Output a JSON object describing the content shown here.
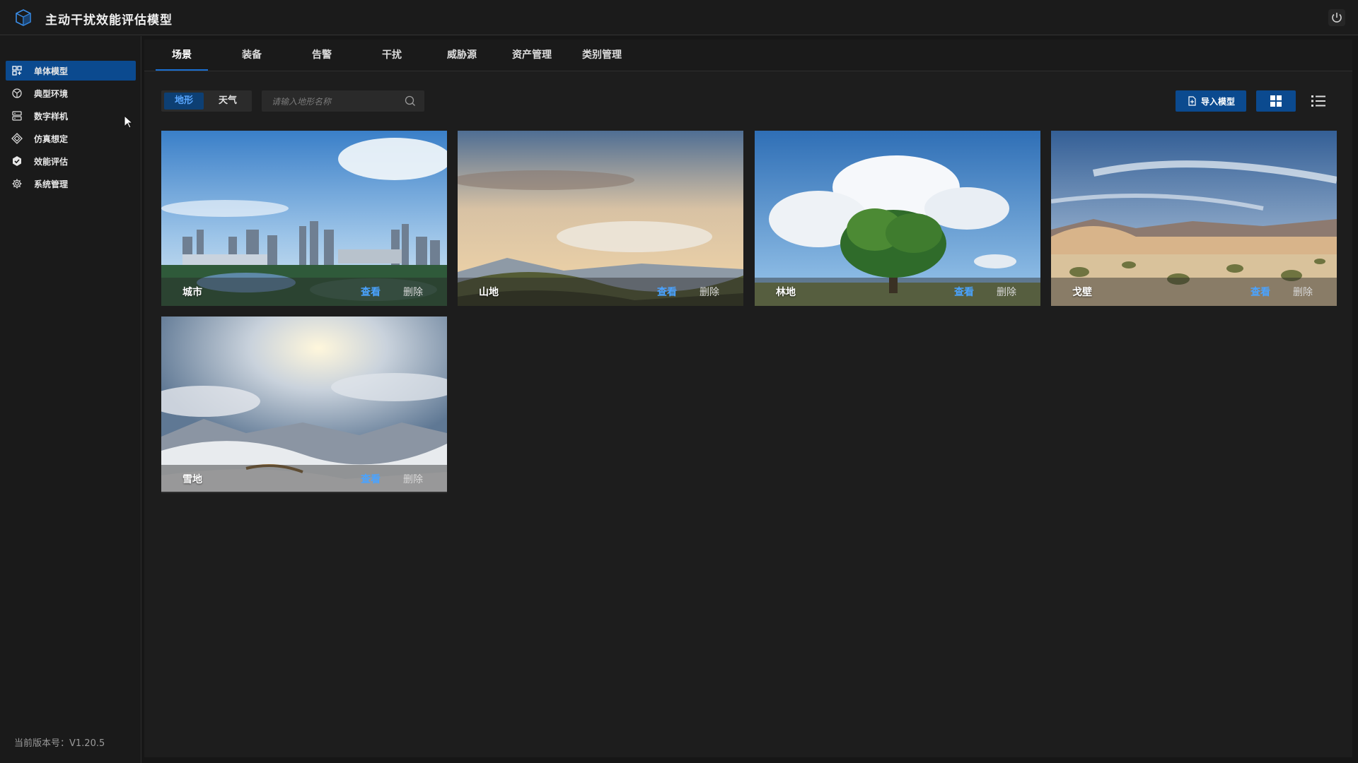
{
  "app": {
    "title": "主动干扰效能评估模型",
    "version": "当前版本号：V1.20.5"
  },
  "sidebar": {
    "items": [
      {
        "label": "单体模型",
        "icon": "model-icon",
        "active": true
      },
      {
        "label": "典型环境",
        "icon": "environment-icon",
        "active": false
      },
      {
        "label": "数字样机",
        "icon": "prototype-icon",
        "active": false
      },
      {
        "label": "仿真想定",
        "icon": "simulation-icon",
        "active": false
      },
      {
        "label": "效能评估",
        "icon": "evaluation-icon",
        "active": false
      },
      {
        "label": "系统管理",
        "icon": "gear-icon",
        "active": false
      }
    ]
  },
  "tabs": [
    "场景",
    "装备",
    "告警",
    "干扰",
    "威胁源",
    "资产管理",
    "类别管理"
  ],
  "active_tab": "场景",
  "filter": {
    "options": [
      "地形",
      "天气"
    ],
    "selected": "地形"
  },
  "search": {
    "placeholder": "请输入地形名称",
    "value": ""
  },
  "toolbar": {
    "import_label": "导入模型"
  },
  "cards": [
    {
      "name": "城市",
      "view": "查看",
      "delete": "删除"
    },
    {
      "name": "山地",
      "view": "查看",
      "delete": "删除"
    },
    {
      "name": "林地",
      "view": "查看",
      "delete": "删除"
    },
    {
      "name": "戈壁",
      "view": "查看",
      "delete": "删除"
    },
    {
      "name": "雪地",
      "view": "查看",
      "delete": "删除"
    }
  ],
  "colors": {
    "accent": "#0b4a8f",
    "link": "#4aa3ff",
    "background": "#161616"
  }
}
